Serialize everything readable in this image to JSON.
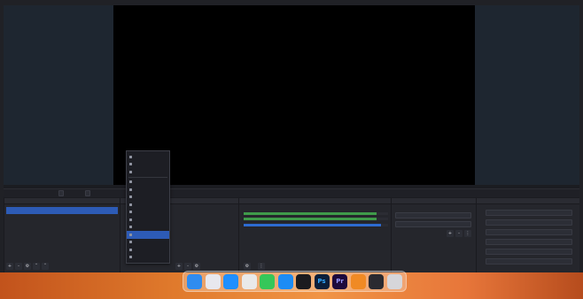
{
  "app": {
    "preview": {
      "side_color": "#1e2630",
      "canvas_color": "#000000"
    },
    "scene_bar": {
      "title": "",
      "buttons": [
        "",
        ""
      ]
    },
    "docks": {
      "scenes": {
        "title": "",
        "items": [
          ""
        ],
        "toolbar": [
          "+",
          "-",
          "⚙",
          "˄",
          "˅"
        ]
      },
      "sources": {
        "title": "",
        "toolbar": [
          "+",
          "-",
          "⚙",
          "˄",
          "˅"
        ]
      },
      "mixer": {
        "title": "",
        "toolbar": [
          "⚙",
          "⋮"
        ]
      },
      "transitions": {
        "title": "",
        "fields": [
          "",
          ""
        ],
        "toolbar": [
          "+",
          "-",
          "⋮"
        ]
      },
      "controls": {
        "title": "",
        "buttons": [
          "",
          "",
          "",
          "",
          "",
          "",
          ""
        ]
      }
    },
    "status_bar": "",
    "context_menu": {
      "items": [
        {
          "label": "",
          "icon": "source-icon",
          "active": false
        },
        {
          "label": "",
          "icon": "source-icon",
          "active": false
        },
        {
          "label": "",
          "icon": "source-icon",
          "active": false
        },
        {
          "label": "",
          "icon": "source-icon",
          "active": false
        },
        {
          "label": "",
          "icon": "source-icon",
          "active": false
        },
        {
          "label": "",
          "icon": "source-icon",
          "active": false
        },
        {
          "label": "",
          "icon": "source-icon",
          "active": false
        },
        {
          "label": "",
          "icon": "source-icon",
          "active": false
        },
        {
          "label": "",
          "icon": "source-icon",
          "active": false
        },
        {
          "label": "",
          "icon": "source-icon",
          "active": false
        },
        {
          "label": "",
          "icon": "source-icon",
          "active": true
        },
        {
          "label": "",
          "icon": "source-icon",
          "active": false
        },
        {
          "label": "",
          "icon": "source-icon",
          "active": false
        },
        {
          "label": "",
          "icon": "source-icon",
          "active": false
        }
      ],
      "group_label": ""
    }
  },
  "dock_apps": [
    {
      "name": "finder-icon",
      "color": "#2f8cf0"
    },
    {
      "name": "launchpad-icon",
      "color": "#e8e8ee"
    },
    {
      "name": "safari-icon",
      "color": "#1f8fff"
    },
    {
      "name": "chrome-icon",
      "color": "#e9e9e9"
    },
    {
      "name": "messages-icon",
      "color": "#35c759"
    },
    {
      "name": "app-store-icon",
      "color": "#1c8cf5"
    },
    {
      "name": "obs-icon",
      "color": "#1b1b1f"
    },
    {
      "name": "photoshop-icon",
      "color": "#0b1f3a",
      "glyph": "Ps",
      "glyph_color": "#31a8ff"
    },
    {
      "name": "premiere-icon",
      "color": "#1e0a3c",
      "glyph": "Pr",
      "glyph_color": "#9999ff"
    },
    {
      "name": "vlc-icon",
      "color": "#f08a24"
    },
    {
      "name": "davinci-icon",
      "color": "#2a2a30"
    },
    {
      "name": "trash-icon",
      "color": "#d6d6da"
    }
  ],
  "colors": {
    "accent": "#2d5bb6",
    "desktop": "#e07a2c"
  }
}
